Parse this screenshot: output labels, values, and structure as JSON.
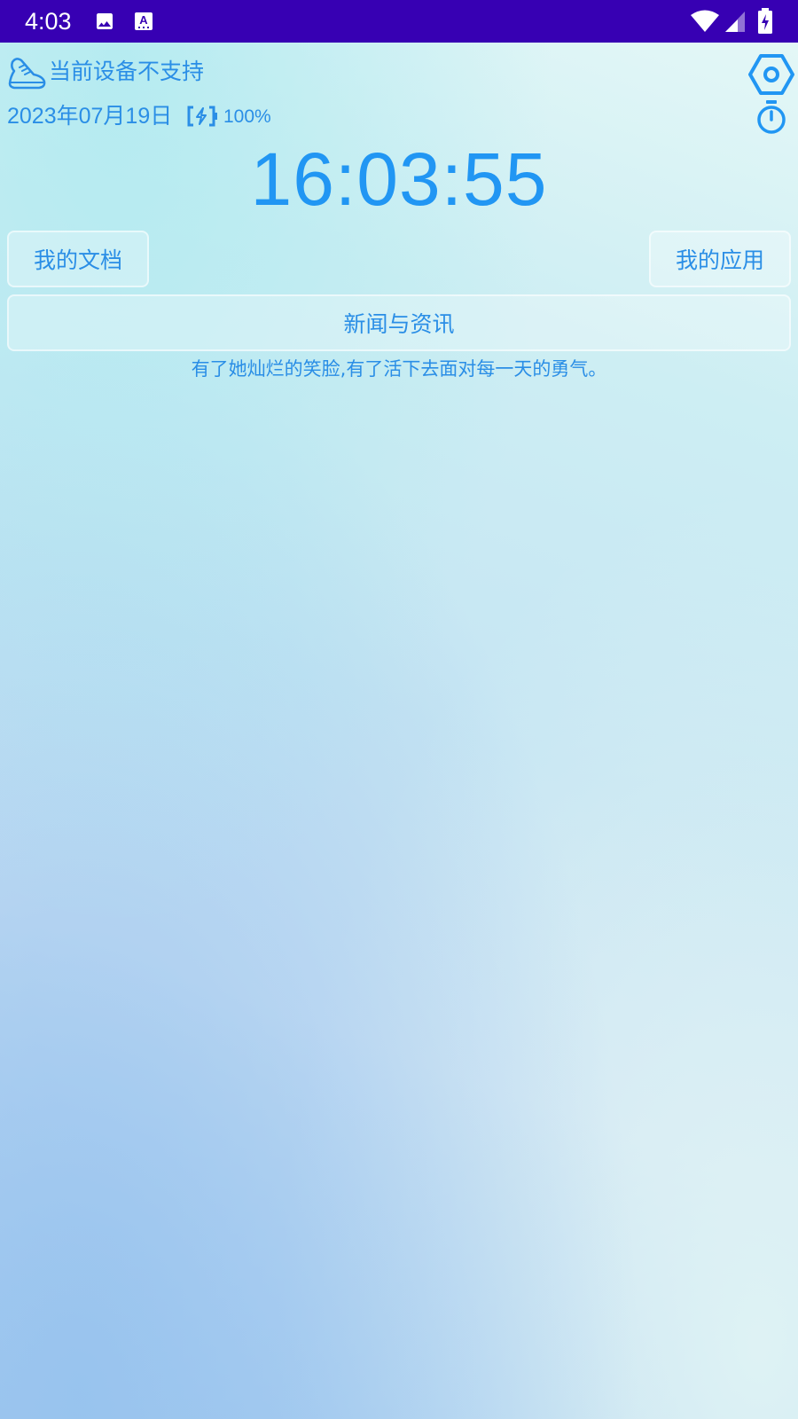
{
  "status_bar": {
    "time": "4:03",
    "background_color": "#3700b3",
    "icons": [
      "image-icon",
      "text-format-icon",
      "wifi-icon",
      "signal-icon",
      "battery-charging-icon"
    ]
  },
  "header": {
    "step_label": "当前设备不支持",
    "left_icon": "shoe-icon",
    "right_icon": "settings-hexagon-icon"
  },
  "date_row": {
    "date": "2023年07月19日",
    "battery_percent": "100%",
    "battery_icon": "battery-charging-icon",
    "timer_icon": "stopwatch-icon"
  },
  "clock": {
    "time": "16:03:55"
  },
  "buttons": {
    "docs": "我的文档",
    "apps": "我的应用",
    "news": "新闻与资讯"
  },
  "quote": "有了她灿烂的笑脸,有了活下去面对每一天的勇气。",
  "colors": {
    "accent": "#2196f3",
    "text": "#2a8ee6"
  }
}
